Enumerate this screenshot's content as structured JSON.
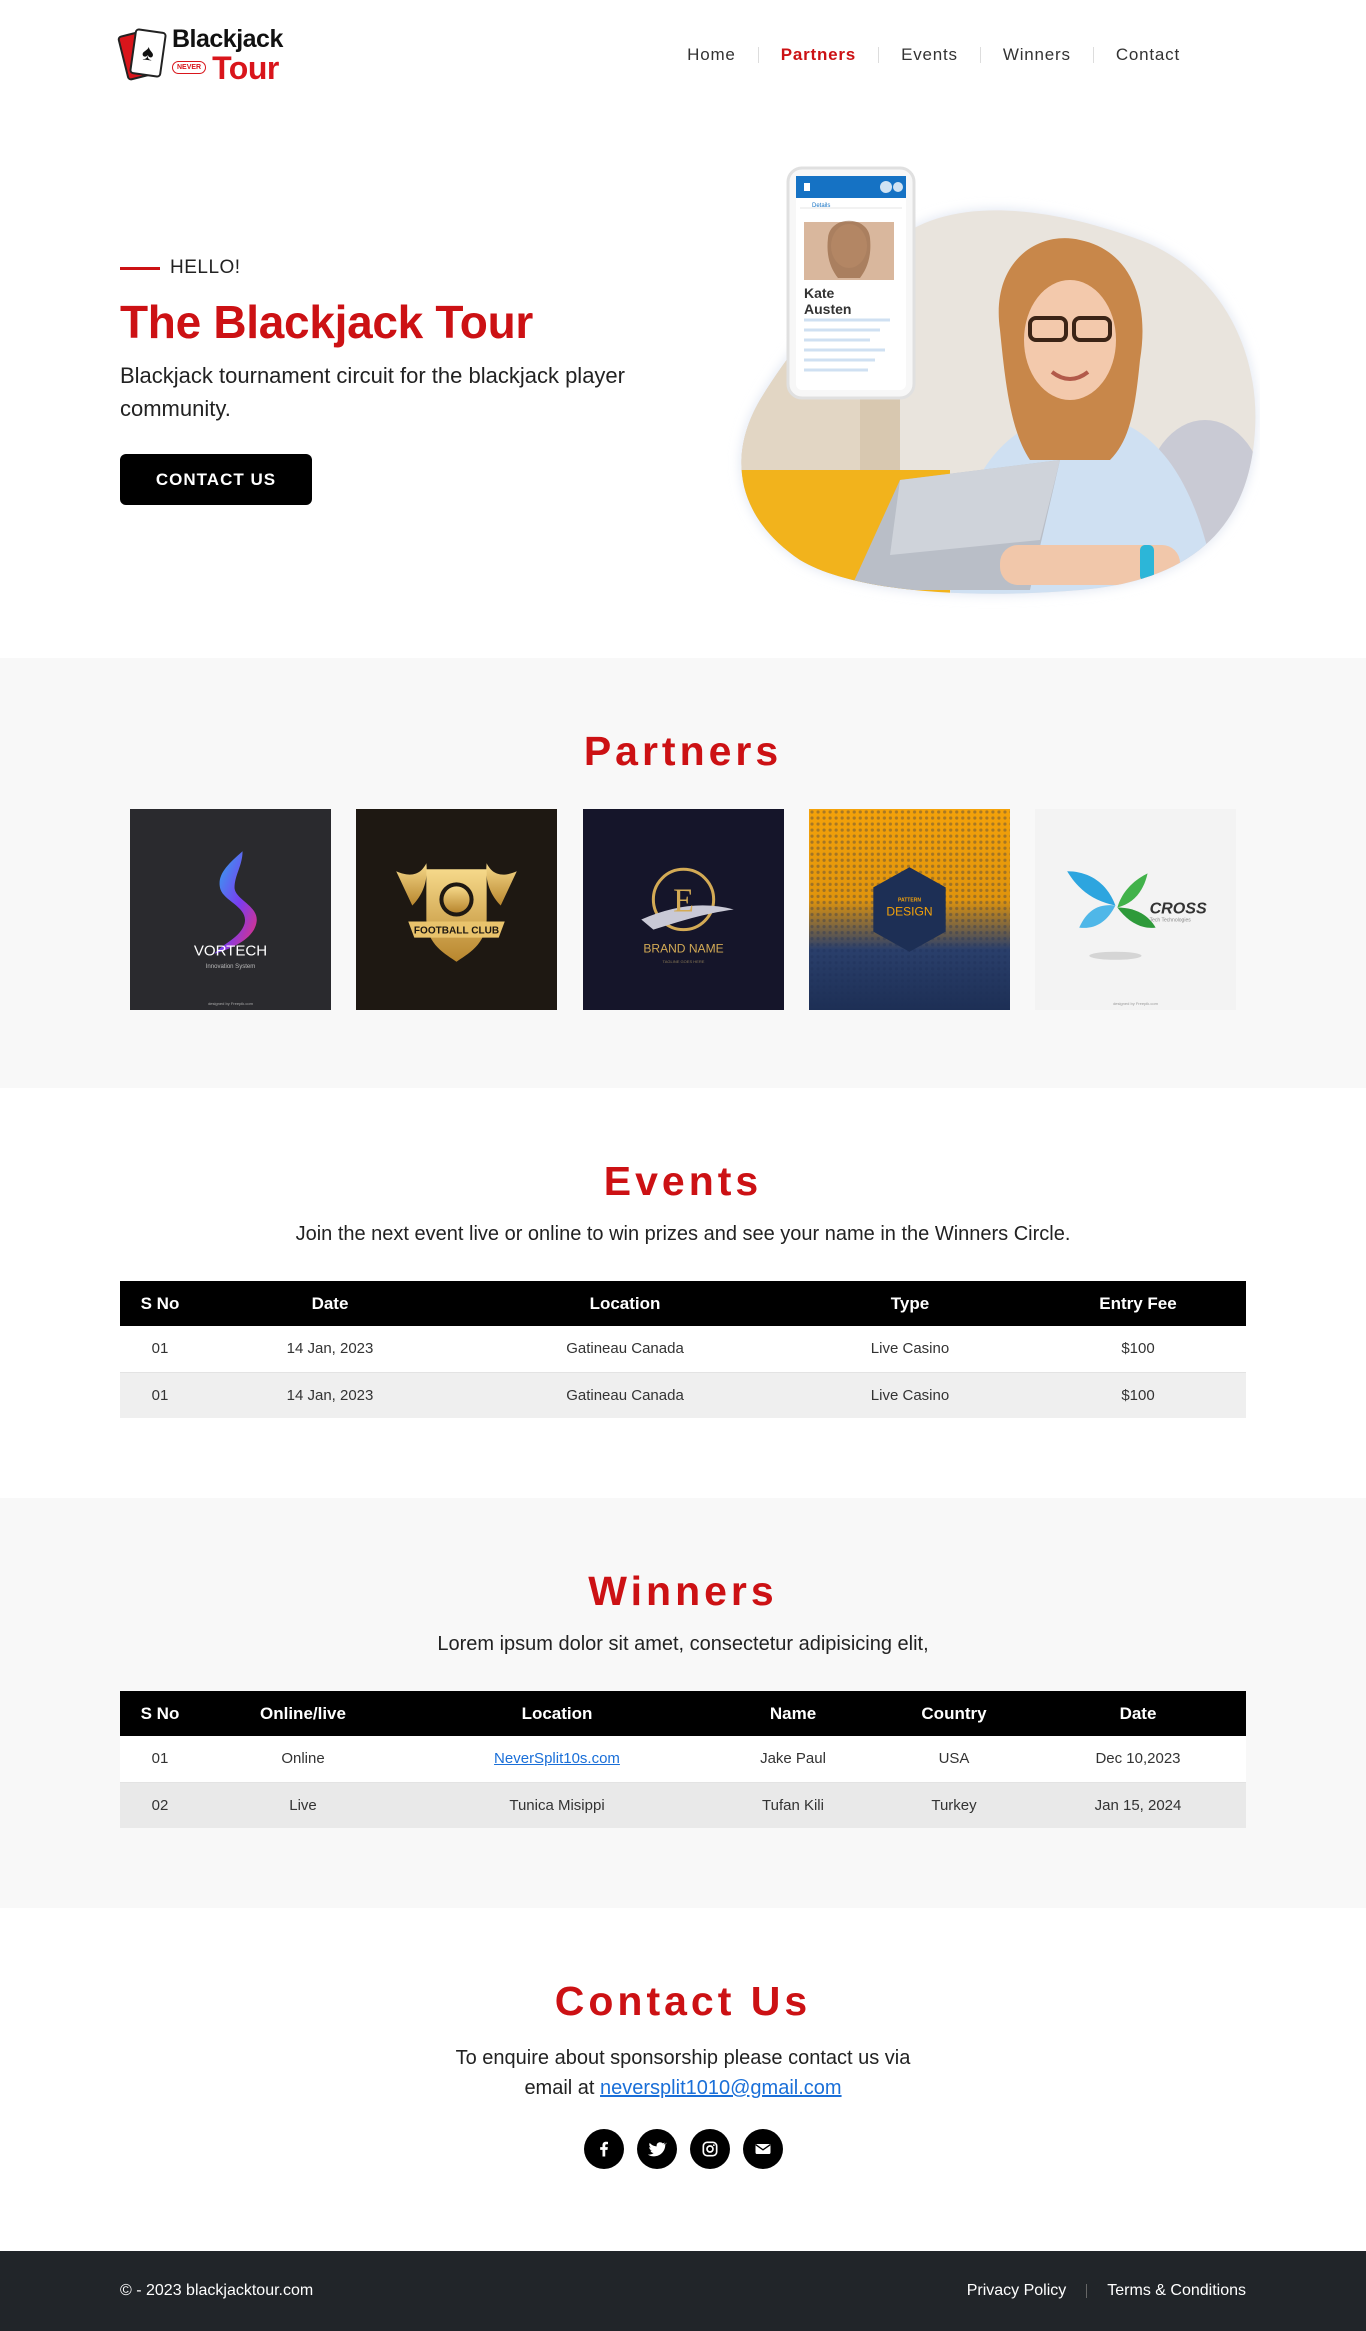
{
  "brand": {
    "line1": "Blackjack",
    "tag": "NEVER",
    "line2": "Tour"
  },
  "nav": {
    "items": [
      {
        "label": "Home"
      },
      {
        "label": "Partners"
      },
      {
        "label": "Events"
      },
      {
        "label": "Winners"
      },
      {
        "label": "Contact"
      }
    ],
    "active": "Partners"
  },
  "hero": {
    "kicker": "HELLO!",
    "title": "The Blackjack Tour",
    "subtitle": "Blackjack tournament circuit for the blackjack player community.",
    "cta": "CONTACT US",
    "phone_card": {
      "name_first": "Kate",
      "name_last": "Austen",
      "tab": "Details"
    }
  },
  "partners": {
    "title": "Partners",
    "logos": [
      {
        "name": "VORTECH",
        "tagline": "Innovation System",
        "credit": "designed by Freepik.com",
        "bg": "#2a2a2e"
      },
      {
        "name": "FOOTBALL CLUB",
        "bg": "#1e1812"
      },
      {
        "name": "BRAND NAME",
        "letter": "E",
        "tagline": "TAGLINE GOES HERE",
        "bg": "#15152a"
      },
      {
        "name": "DESIGN",
        "top": "PATTERN",
        "bg": "#f4a20a"
      },
      {
        "name": "CROSS",
        "tagline": "Tech Technologies",
        "credit": "designed by Freepik.com",
        "bg": "#f3f3f3"
      }
    ]
  },
  "events": {
    "title": "Events",
    "subtitle": "Join the next event live or online to win prizes and see your name in the Winners Circle.",
    "columns": [
      "S No",
      "Date",
      "Location",
      "Type",
      "Entry Fee"
    ],
    "rows": [
      [
        "01",
        "14 Jan, 2023",
        "Gatineau Canada",
        "Live Casino",
        "$100"
      ],
      [
        "01",
        "14 Jan, 2023",
        "Gatineau Canada",
        "Live Casino",
        "$100"
      ]
    ]
  },
  "winners": {
    "title": "Winners",
    "subtitle": "Lorem ipsum dolor sit amet, consectetur adipisicing elit,",
    "columns": [
      "S No",
      "Online/live",
      "Location",
      "Name",
      "Country",
      "Date"
    ],
    "rows": [
      [
        "01",
        "Online",
        "NeverSplit10s.com",
        "Jake Paul",
        "USA",
        "Dec 10,2023"
      ],
      [
        "02",
        "Live",
        "Tunica Misippi",
        "Tufan Kili",
        "Turkey",
        "Jan 15, 2024"
      ]
    ]
  },
  "contact": {
    "title": "Contact Us",
    "line1": "To enquire about sponsorship please contact us via",
    "line2_prefix": "email at",
    "email": "neversplit1010@gmail.com",
    "socials": [
      "facebook-icon",
      "twitter-icon",
      "instagram-icon",
      "envelope-icon"
    ]
  },
  "footer": {
    "copyright": "© - 2023 blackjacktour.com",
    "privacy": "Privacy Policy",
    "terms": "Terms & Conditions"
  },
  "colors": {
    "accent": "#cc1114",
    "dark": "#000000",
    "footer": "#212529",
    "link": "#1a6fd8"
  }
}
